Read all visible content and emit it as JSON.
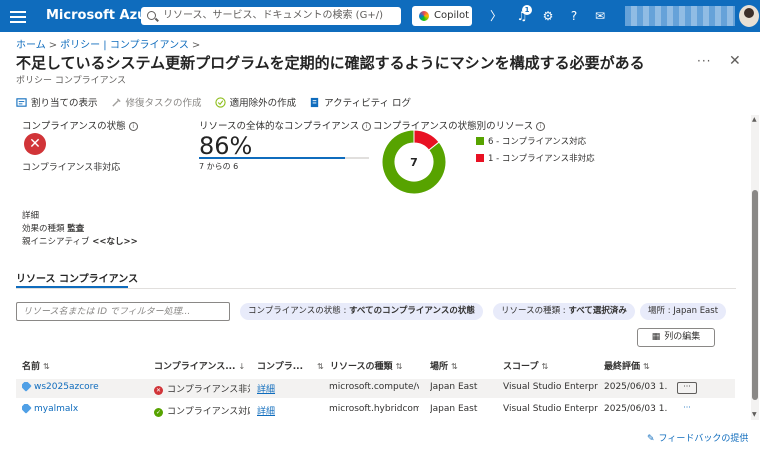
{
  "topbar": {
    "brand": "Microsoft Azure",
    "search_placeholder": "リソース、サービス、ドキュメントの検索 (G+/)",
    "copilot_label": "Copilot",
    "notification_count": "1"
  },
  "breadcrumb": [
    "ホーム",
    "ポリシー | コンプライアンス"
  ],
  "header": {
    "title": "不足しているシステム更新プログラムを定期的に確認するようにマシンを構成する必要がある",
    "subtitle": "ポリシー コンプライアンス",
    "more": "···"
  },
  "toolbar": {
    "items": [
      {
        "label": "割り当ての表示",
        "icon": "assignment-icon",
        "disabled": false
      },
      {
        "label": "修復タスクの作成",
        "icon": "remediation-icon",
        "disabled": true
      },
      {
        "label": "適用除外の作成",
        "icon": "exemption-icon",
        "disabled": false
      },
      {
        "label": "アクティビティ ログ",
        "icon": "activity-log-icon",
        "disabled": false
      }
    ]
  },
  "summary": {
    "state_title": "コンプライアンスの状態",
    "state_value": "コンプライアンス非対応",
    "overall_title": "リソースの全体的なコンプライアンス",
    "overall_percent": "86%",
    "overall_fraction": 0.86,
    "overall_detail": "7 からの 6",
    "donut_title": "コンプライアンスの状態別のリソース",
    "donut_total": "7",
    "details_title": "詳細",
    "effect_label": "効果の種類",
    "effect_value": "監査",
    "initiative_label": "親イニシアティブ",
    "initiative_value": "<<なし>>"
  },
  "chart_data": {
    "type": "pie",
    "categories": [
      "6 - コンプライアンス対応",
      "1 - コンプライアンス非対応"
    ],
    "values": [
      6,
      1
    ],
    "colors": [
      "#57a300",
      "#e81123"
    ],
    "legend": "right"
  },
  "tab": {
    "label": "リソース コンプライアンス"
  },
  "filters": {
    "search_placeholder": "リソース名または ID でフィルター処理...",
    "pills": [
      {
        "key": "コンプライアンスの状態 : ",
        "value": "すべてのコンプライアンスの状態"
      },
      {
        "key": "リソースの種類 : ",
        "value": "すべて選択済み"
      },
      {
        "key": "場所 : ",
        "value": "Japan East"
      }
    ],
    "edit_columns": "列の編集"
  },
  "table": {
    "columns": [
      "名前",
      "コンプライアンス...",
      "コンプラ...",
      "リソースの種類",
      "場所",
      "スコープ",
      "最終評価"
    ],
    "rows": [
      {
        "name": "ws2025azcore",
        "status": "コンプライアンス非対応",
        "status_type": "noncompliant",
        "detail": "詳細",
        "type": "microsoft.compute/vi...",
        "location": "Japan East",
        "scope": "Visual Studio Enterpri...",
        "last_eval": "2025/06/03 1..."
      },
      {
        "name": "myalmalx",
        "status": "コンプライアンス対応",
        "status_type": "compliant",
        "detail": "詳細",
        "type": "microsoft.hybridcom...",
        "location": "Japan East",
        "scope": "Visual Studio Enterpri...",
        "last_eval": "2025/06/03 1..."
      }
    ]
  },
  "footer": {
    "feedback": "フィードバックの提供"
  }
}
